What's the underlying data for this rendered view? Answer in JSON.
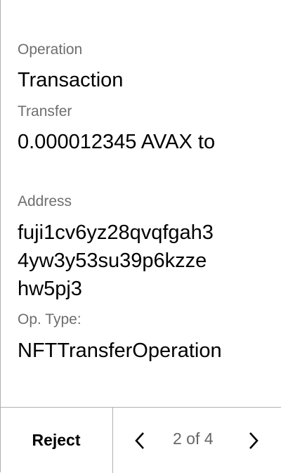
{
  "fields": [
    {
      "label": "Operation",
      "value": "Transaction"
    },
    {
      "label": "Transfer",
      "value": "0.000012345 AVAX to"
    },
    {
      "label": "Address",
      "value": "fuji1cv6yz28qvqfgah3\n4yw3y53su39p6kzze\nhw5pj3"
    },
    {
      "label": "Op. Type:",
      "value": "NFTTransferOperation"
    }
  ],
  "footer": {
    "reject_label": "Reject",
    "page_indicator": "2 of 4",
    "prev_icon": "chevron-left-icon",
    "next_icon": "chevron-right-icon"
  }
}
